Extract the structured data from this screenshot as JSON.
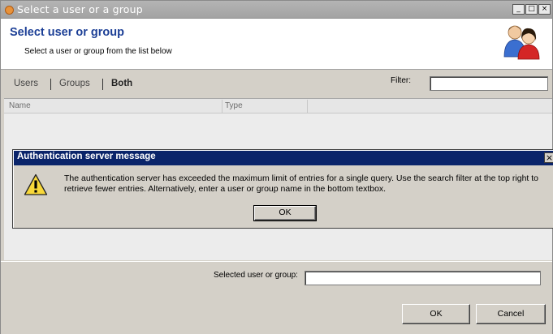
{
  "window": {
    "title": "Select a user or a group",
    "controls": {
      "minimize": "_",
      "maximize": "□",
      "close": "×"
    }
  },
  "header": {
    "title": "Select user or group",
    "subtitle": "Select a user or group from the list below",
    "icon": "users-icon"
  },
  "tabs": [
    {
      "label": "Users",
      "selected": false
    },
    {
      "label": "Groups",
      "selected": false
    },
    {
      "label": "Both",
      "selected": true
    }
  ],
  "filter": {
    "label": "Filter:",
    "value": ""
  },
  "list": {
    "columns": [
      "Name",
      "Type"
    ],
    "rows": []
  },
  "selected": {
    "label": "Selected user or group:",
    "value": ""
  },
  "buttons": {
    "ok": "OK",
    "cancel": "Cancel"
  },
  "dialog": {
    "title": "Authentication server message",
    "close": "×",
    "icon": "warning-icon",
    "message": "The authentication server has exceeded the maximum limit of entries for a single query. Use the search filter at the top right to retrieve fewer entries. Alternatively, enter a user or group name in the bottom textbox.",
    "ok": "OK"
  },
  "colors": {
    "header_title": "#1c3f96",
    "dialog_titlebar": "#0a246a",
    "window_titlebar": "#a8a8a8"
  }
}
